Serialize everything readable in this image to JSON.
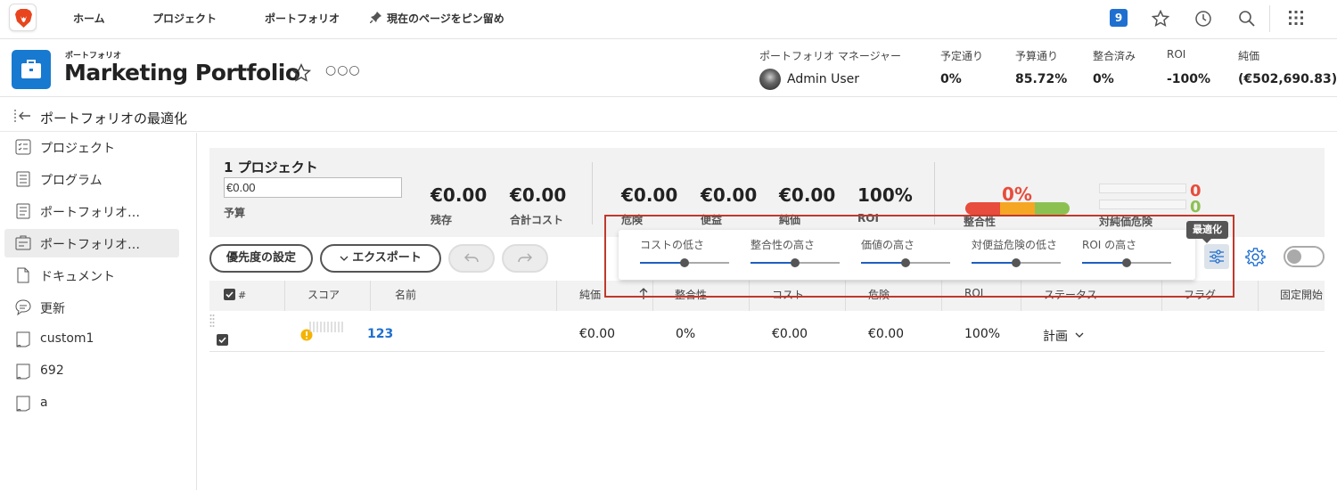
{
  "topnav": {
    "links": [
      "ホーム",
      "プロジェクト",
      "ポートフォリオ"
    ],
    "pin_label": "現在のページをピン留め",
    "notification_count": "9"
  },
  "header": {
    "kicker": "ポートフォリオ",
    "title": "Marketing Portfolio",
    "more": "○○○",
    "manager_label": "ポートフォリオ マネージャー",
    "manager_name": "Admin User",
    "stats": [
      {
        "label": "予定通り",
        "value": "0%"
      },
      {
        "label": "予算通り",
        "value": "85.72%"
      },
      {
        "label": "整合済み",
        "value": "0%"
      },
      {
        "label": "ROI",
        "value": "-100%"
      },
      {
        "label": "純価",
        "value": "(€502,690.83)"
      }
    ]
  },
  "subbar": {
    "title": "ポートフォリオの最適化"
  },
  "sidebar": {
    "items": [
      {
        "label": "プロジェクト",
        "icon": "project-list-icon"
      },
      {
        "label": "プログラム",
        "icon": "program-list-icon"
      },
      {
        "label": "ポートフォリオ…",
        "icon": "portfolio-list-icon"
      },
      {
        "label": "ポートフォリオ…",
        "icon": "portfolio-optimizer-icon"
      },
      {
        "label": "ドキュメント",
        "icon": "document-icon"
      },
      {
        "label": "更新",
        "icon": "comment-icon"
      },
      {
        "label": "custom1",
        "icon": "custom-form-icon"
      },
      {
        "label": "692",
        "icon": "custom-form-icon"
      },
      {
        "label": "a",
        "icon": "custom-form-icon"
      }
    ]
  },
  "summary": {
    "count": "1 プロジェクト",
    "budget_value": "€0.00",
    "budget_label": "予算",
    "remaining_value": "€0.00",
    "remaining_label": "残存",
    "total_cost_value": "€0.00",
    "total_cost_label": "合計コスト",
    "risk_value": "€0.00",
    "risk_label": "危険",
    "benefit_value": "€0.00",
    "benefit_label": "便益",
    "net_value": "€0.00",
    "net_label": "純価",
    "roi_value": "100%",
    "roi_label": "ROI",
    "alignment_value": "0%",
    "alignment_label": "整合性",
    "risk_to_net_label": "対純価危険",
    "risk_zero_1": "0",
    "risk_zero_2": "0"
  },
  "toolbar": {
    "priority_label": "優先度の設定",
    "export_label": "エクスポート",
    "export_icon": "chevron-down-icon",
    "undo_icon": "undo-icon",
    "redo_icon": "redo-icon"
  },
  "optimizer": {
    "tooltip": "最適化",
    "sliders": [
      {
        "label": "コストの低さ",
        "value": 0.5
      },
      {
        "label": "整合性の高さ",
        "value": 0.5
      },
      {
        "label": "価値の高さ",
        "value": 0.5
      },
      {
        "label": "対便益危険の低さ",
        "value": 0.5
      },
      {
        "label": "ROI の高さ",
        "value": 0.5
      }
    ]
  },
  "table": {
    "columns": [
      "#",
      "スコア",
      "名前",
      "純価",
      "整合性",
      "コスト",
      "危険",
      "ROI",
      "ステータス",
      "フラグ",
      "固定開始"
    ],
    "rows": [
      {
        "name": "123",
        "net": "€0.00",
        "alignment": "0%",
        "cost": "€0.00",
        "risk": "€0.00",
        "roi": "100%",
        "status": "計画",
        "checked": true
      }
    ]
  },
  "colors": {
    "accent": "#1879d0",
    "highlight_border": "#c0392b",
    "bar_red": "#e74c3c",
    "bar_orange": "#f5a623",
    "bar_green": "#8cc152"
  }
}
